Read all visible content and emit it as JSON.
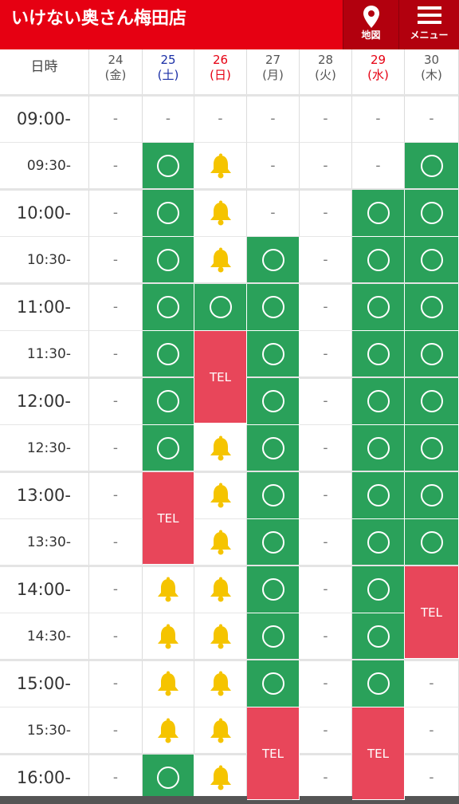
{
  "header": {
    "title": "いけない奥さん梅田店",
    "map_label": "地図",
    "menu_label": "メニュー"
  },
  "table": {
    "corner_label": "日時",
    "dates": [
      {
        "day": "24",
        "weekday": "(金)",
        "color": "#555555"
      },
      {
        "day": "25",
        "weekday": "(土)",
        "color": "#1a2fa6"
      },
      {
        "day": "26",
        "weekday": "(日)",
        "color": "#e60012"
      },
      {
        "day": "27",
        "weekday": "(月)",
        "color": "#555555"
      },
      {
        "day": "28",
        "weekday": "(火)",
        "color": "#555555"
      },
      {
        "day": "29",
        "weekday": "(水)",
        "color": "#e60012"
      },
      {
        "day": "30",
        "weekday": "(木)",
        "color": "#555555"
      }
    ],
    "times": [
      "09:00-",
      "09:30-",
      "10:00-",
      "10:30-",
      "11:00-",
      "11:30-",
      "12:00-",
      "12:30-",
      "13:00-",
      "13:30-",
      "14:00-",
      "14:30-",
      "15:00-",
      "15:30-",
      "16:00-"
    ],
    "tel_label": "TEL",
    "dash_label": "-",
    "statuses": [
      [
        "-",
        "-",
        "-",
        "-",
        "-",
        "-",
        "-"
      ],
      [
        "-",
        "ok",
        "bell",
        "-",
        "-",
        "-",
        "ok"
      ],
      [
        "-",
        "ok",
        "bell",
        "-",
        "-",
        "ok",
        "ok"
      ],
      [
        "-",
        "ok",
        "bell",
        "ok",
        "-",
        "ok",
        "ok"
      ],
      [
        "-",
        "ok",
        "ok",
        "ok",
        "-",
        "ok",
        "ok"
      ],
      [
        "-",
        "ok",
        "tel",
        "ok",
        "-",
        "ok",
        "ok"
      ],
      [
        "-",
        "ok",
        "tel",
        "ok",
        "-",
        "ok",
        "ok"
      ],
      [
        "-",
        "ok",
        "bell",
        "ok",
        "-",
        "ok",
        "ok"
      ],
      [
        "-",
        "tel",
        "bell",
        "ok",
        "-",
        "ok",
        "ok"
      ],
      [
        "-",
        "tel",
        "bell",
        "ok",
        "-",
        "ok",
        "ok"
      ],
      [
        "-",
        "bell",
        "bell",
        "ok",
        "-",
        "ok",
        "tel"
      ],
      [
        "-",
        "bell",
        "bell",
        "ok",
        "-",
        "ok",
        "tel"
      ],
      [
        "-",
        "bell",
        "bell",
        "ok",
        "-",
        "ok",
        "-"
      ],
      [
        "-",
        "bell",
        "bell",
        "tel",
        "-",
        "tel",
        "-"
      ],
      [
        "-",
        "ok",
        "bell",
        "tel",
        "-",
        "tel",
        "-"
      ]
    ]
  },
  "colors": {
    "header_red": "#e60012",
    "available_green": "#2aa15a",
    "tel_red": "#e8465a",
    "bell_yellow": "#f5c400"
  },
  "icons": {
    "map": "map-pin-icon",
    "menu": "hamburger-menu-icon",
    "available": "circle-icon",
    "notify": "bell-icon"
  }
}
